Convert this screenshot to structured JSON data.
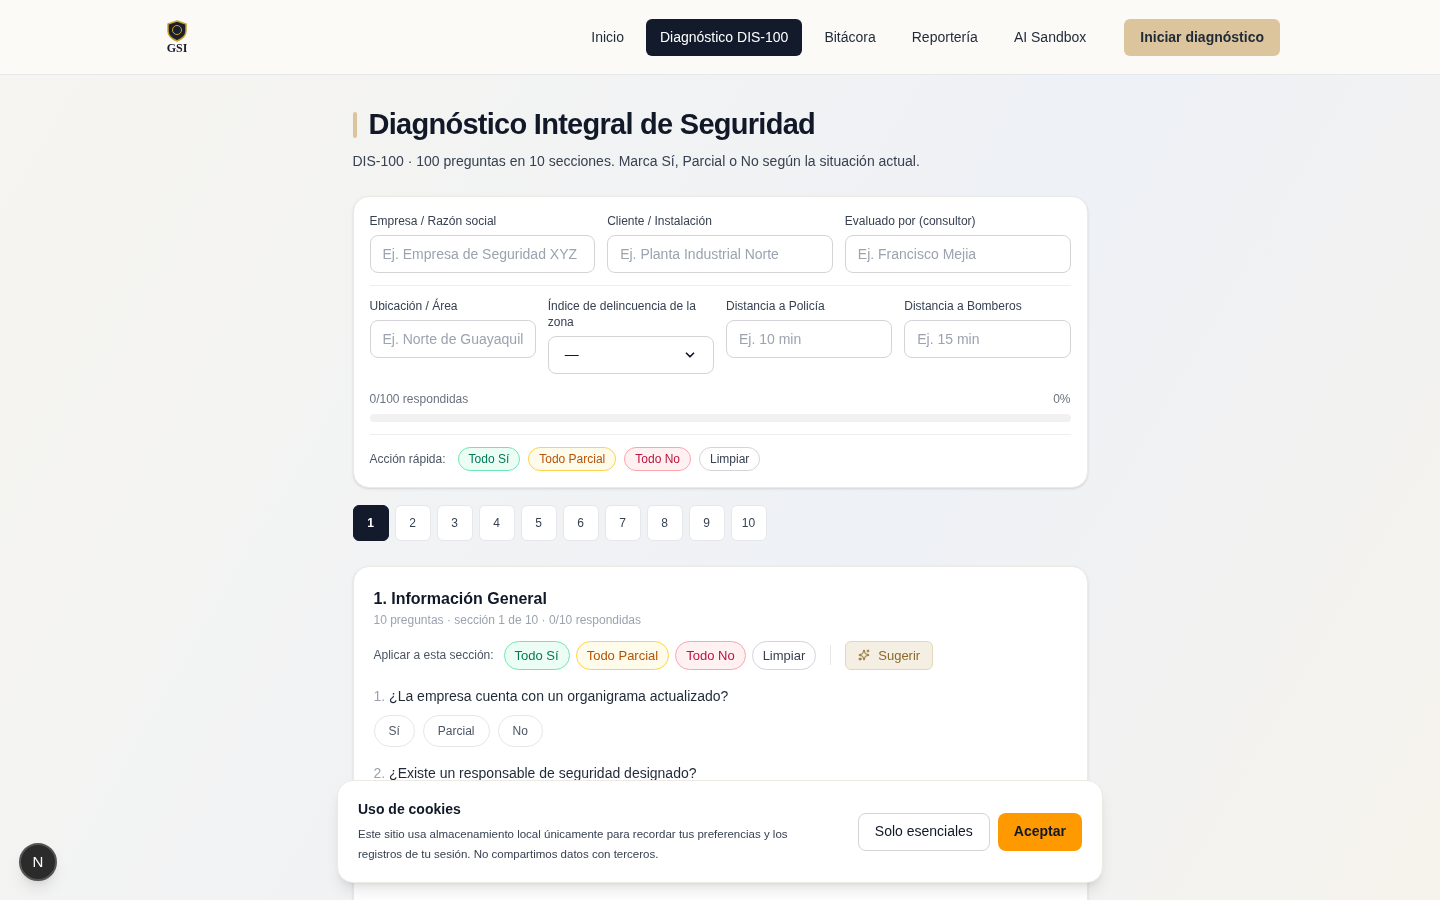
{
  "header": {
    "logo_text": "GSI",
    "nav": [
      {
        "label": "Inicio",
        "selected": false
      },
      {
        "label": "Diagnóstico DIS-100",
        "selected": true
      },
      {
        "label": "Bitácora",
        "selected": false
      },
      {
        "label": "Reportería",
        "selected": false
      },
      {
        "label": "AI Sandbox",
        "selected": false
      }
    ],
    "cta": "Iniciar diagnóstico"
  },
  "page": {
    "title": "Diagnóstico Integral de Seguridad",
    "subtitle": "DIS-100 · 100 preguntas en 10 secciones. Marca Sí, Parcial o No según la situación actual."
  },
  "form": {
    "row_1": [
      {
        "label": "Empresa / Razón social",
        "placeholder": "Ej. Empresa de Seguridad XYZ"
      },
      {
        "label": "Cliente / Instalación",
        "placeholder": "Ej. Planta Industrial Norte"
      },
      {
        "label": "Evaluado por (consultor)",
        "placeholder": "Ej. Francisco Mejia"
      }
    ],
    "row_2": [
      {
        "kind": "input",
        "label": "Ubicación / Área",
        "placeholder": "Ej. Norte de Guayaquil"
      },
      {
        "kind": "select",
        "label": "Índice de delincuencia de la zona",
        "value": "—"
      },
      {
        "kind": "input",
        "label": "Distancia a Policía",
        "placeholder": "Ej. 10 min"
      },
      {
        "kind": "input",
        "label": "Distancia a Bomberos",
        "placeholder": "Ej. 15 min"
      }
    ],
    "progress": {
      "label": "0/100 respondidas",
      "percent": "0%",
      "level": 0
    },
    "quick_actions": {
      "label": "Acción rápida:",
      "buttons": [
        {
          "label": "Todo Sí",
          "kind": "yes"
        },
        {
          "label": "Todo Parcial",
          "kind": "partial"
        },
        {
          "label": "Todo No",
          "kind": "no"
        },
        {
          "label": "Limpiar",
          "kind": "clear"
        }
      ]
    }
  },
  "pagination": [
    {
      "label": "1",
      "selected": true
    },
    {
      "label": "2",
      "selected": false
    },
    {
      "label": "3",
      "selected": false
    },
    {
      "label": "4",
      "selected": false
    },
    {
      "label": "5",
      "selected": false
    },
    {
      "label": "6",
      "selected": false
    },
    {
      "label": "7",
      "selected": false
    },
    {
      "label": "8",
      "selected": false
    },
    {
      "label": "9",
      "selected": false
    },
    {
      "label": "10",
      "selected": false
    }
  ],
  "section": {
    "title": "1. Información General",
    "meta": "10 preguntas · sección 1 de 10 · 0/10 respondidas",
    "apply_label": "Aplicar a esta sección:",
    "buttons": [
      {
        "label": "Todo Sí",
        "kind": "yes"
      },
      {
        "label": "Todo Parcial",
        "kind": "partial"
      },
      {
        "label": "Todo No",
        "kind": "no"
      },
      {
        "label": "Limpiar",
        "kind": "clear"
      }
    ],
    "suggest": "Sugerir",
    "questions": [
      {
        "number": "1.",
        "text": "¿La empresa cuenta con un organigrama actualizado?",
        "options": [
          "Sí",
          "Parcial",
          "No"
        ]
      },
      {
        "number": "2.",
        "text": "¿Existe un responsable de seguridad designado?"
      }
    ]
  },
  "cookie_banner": {
    "title": "Uso de cookies",
    "text": "Este sitio usa almacenamiento local únicamente para recordar tus preferencias y los registros de tu sesión. No compartimos datos con terceros.",
    "secondary": "Solo esenciales",
    "primary": "Aceptar"
  },
  "floating_badge": "N"
}
